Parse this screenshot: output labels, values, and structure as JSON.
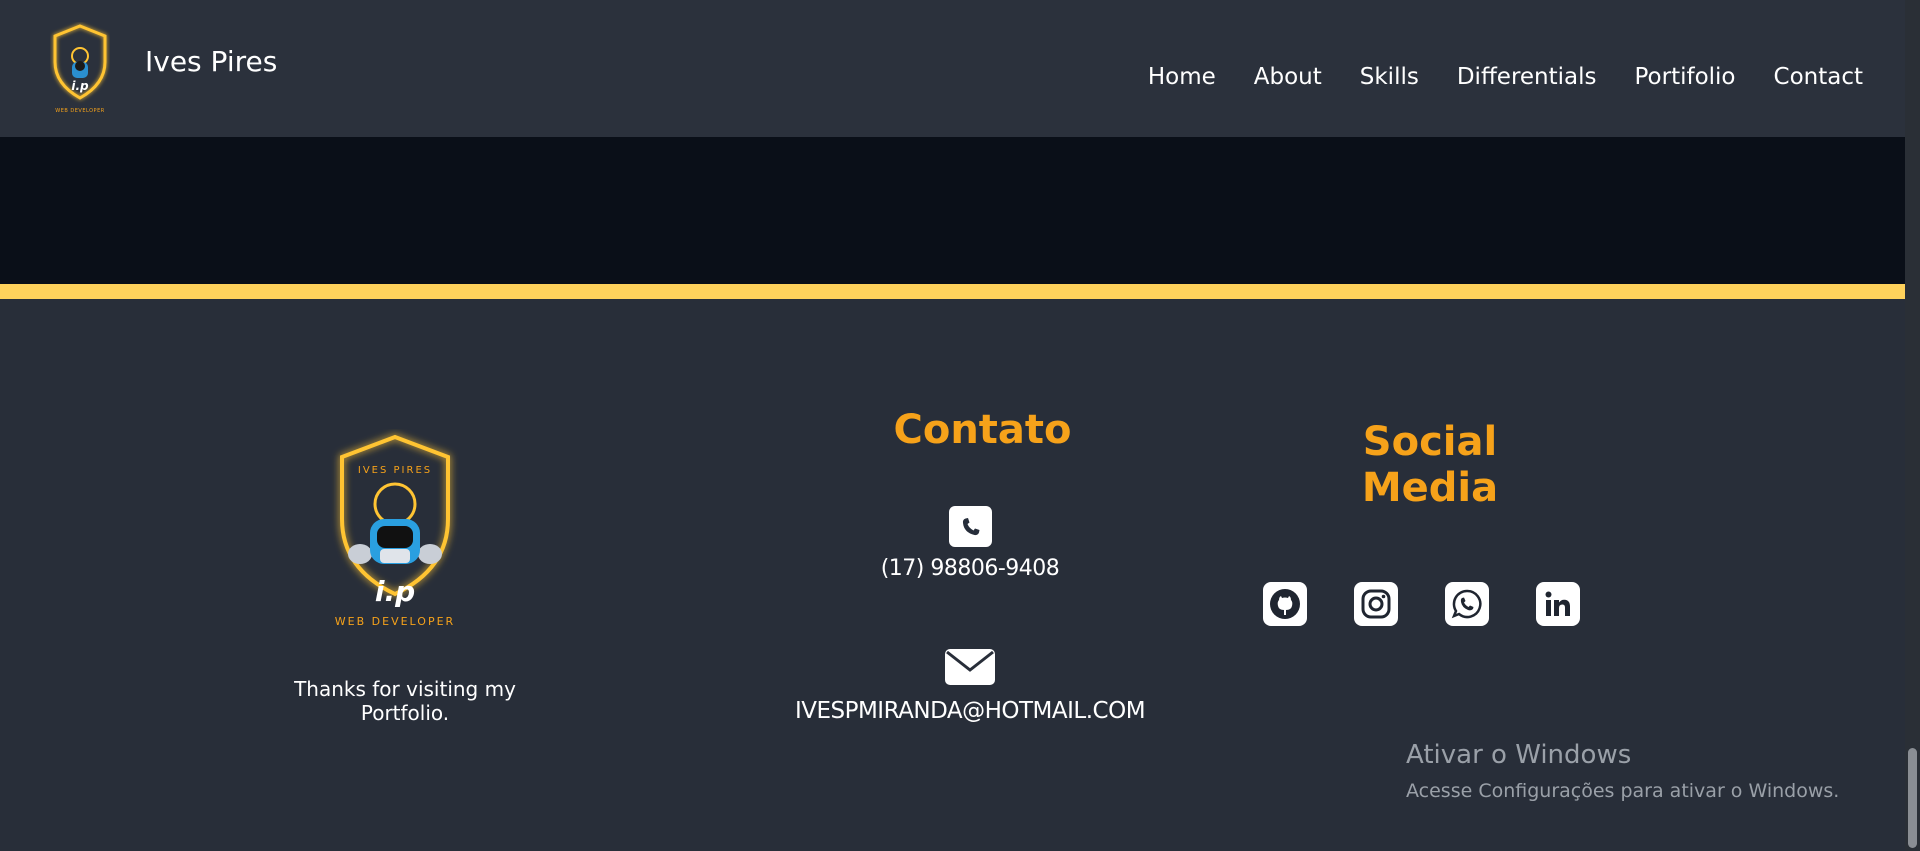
{
  "navbar": {
    "brand": "Ives Pires",
    "logo_caption": "WEB DEVELOPER",
    "logo_initials": "I.P",
    "links": [
      "Home",
      "About",
      "Skills",
      "Differentials",
      "Portifolio",
      "Contact"
    ]
  },
  "footer": {
    "logo_caption": "WEB DEVELOPER",
    "logo_top_text": "IVES PIRES",
    "logo_initials": "I.P",
    "thanks": "Thanks for visiting my Portfolio.",
    "contact": {
      "heading": "Contato",
      "phone": "(17) 98806-9408",
      "email": "IVESPMIRANDA@HOTMAIL.COM"
    },
    "social": {
      "heading": "Social Media",
      "icons": [
        "github-icon",
        "instagram-icon",
        "whatsapp-icon",
        "linkedin-icon"
      ]
    }
  },
  "watermark": {
    "title": "Ativar o Windows",
    "subtitle": "Acesse Configurações para ativar o Windows."
  },
  "colors": {
    "accent": "#f6a21a",
    "stripe": "#ffd25c",
    "navbar_bg": "#2b313c",
    "footer_bg": "#282e39",
    "band_bg": "#0a0f18"
  }
}
